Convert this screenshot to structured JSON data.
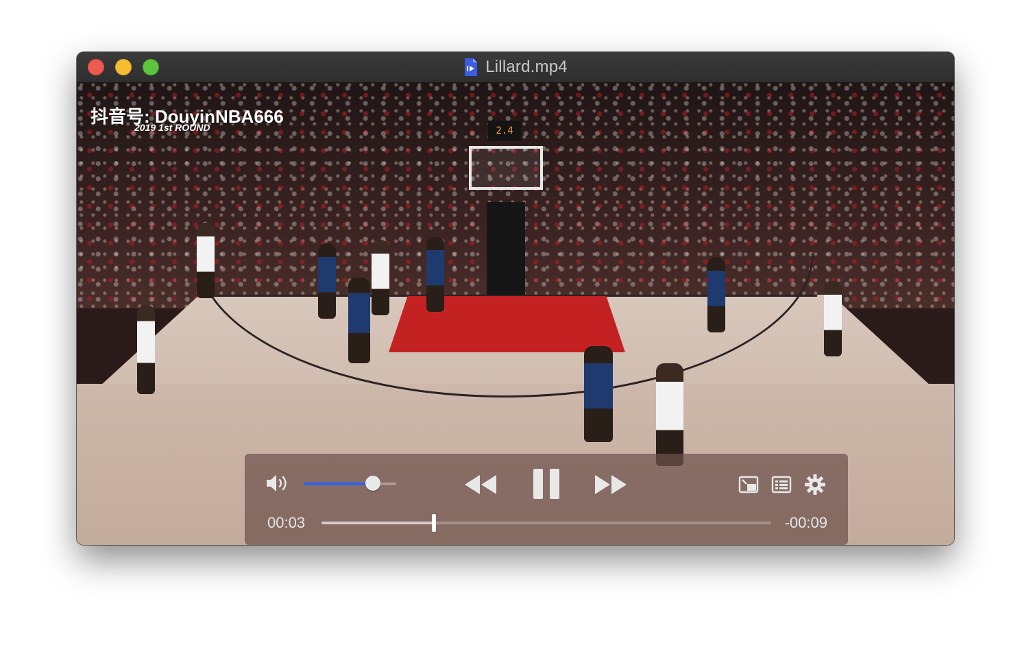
{
  "window": {
    "title": "Lillard.mp4",
    "file_icon": "video-file-icon"
  },
  "video_overlay": {
    "watermark": "抖音号: DouyinNBA666",
    "round_label": "2019 1st ROUND",
    "shot_clock": "2.4"
  },
  "player_controls": {
    "volume": {
      "icon": "speaker-icon",
      "level": 0.75,
      "accent_color": "#2b63f0"
    },
    "rewind": {
      "icon": "rewind-icon"
    },
    "play_pause": {
      "icon": "pause-icon",
      "state": "playing"
    },
    "fast_forward": {
      "icon": "fast-forward-icon"
    },
    "picture_in_picture": {
      "icon": "picture-in-picture-icon"
    },
    "playlist": {
      "icon": "list-icon"
    },
    "settings": {
      "icon": "gear-icon"
    },
    "elapsed": "00:03",
    "remaining": "-00:09",
    "progress": 0.25
  }
}
